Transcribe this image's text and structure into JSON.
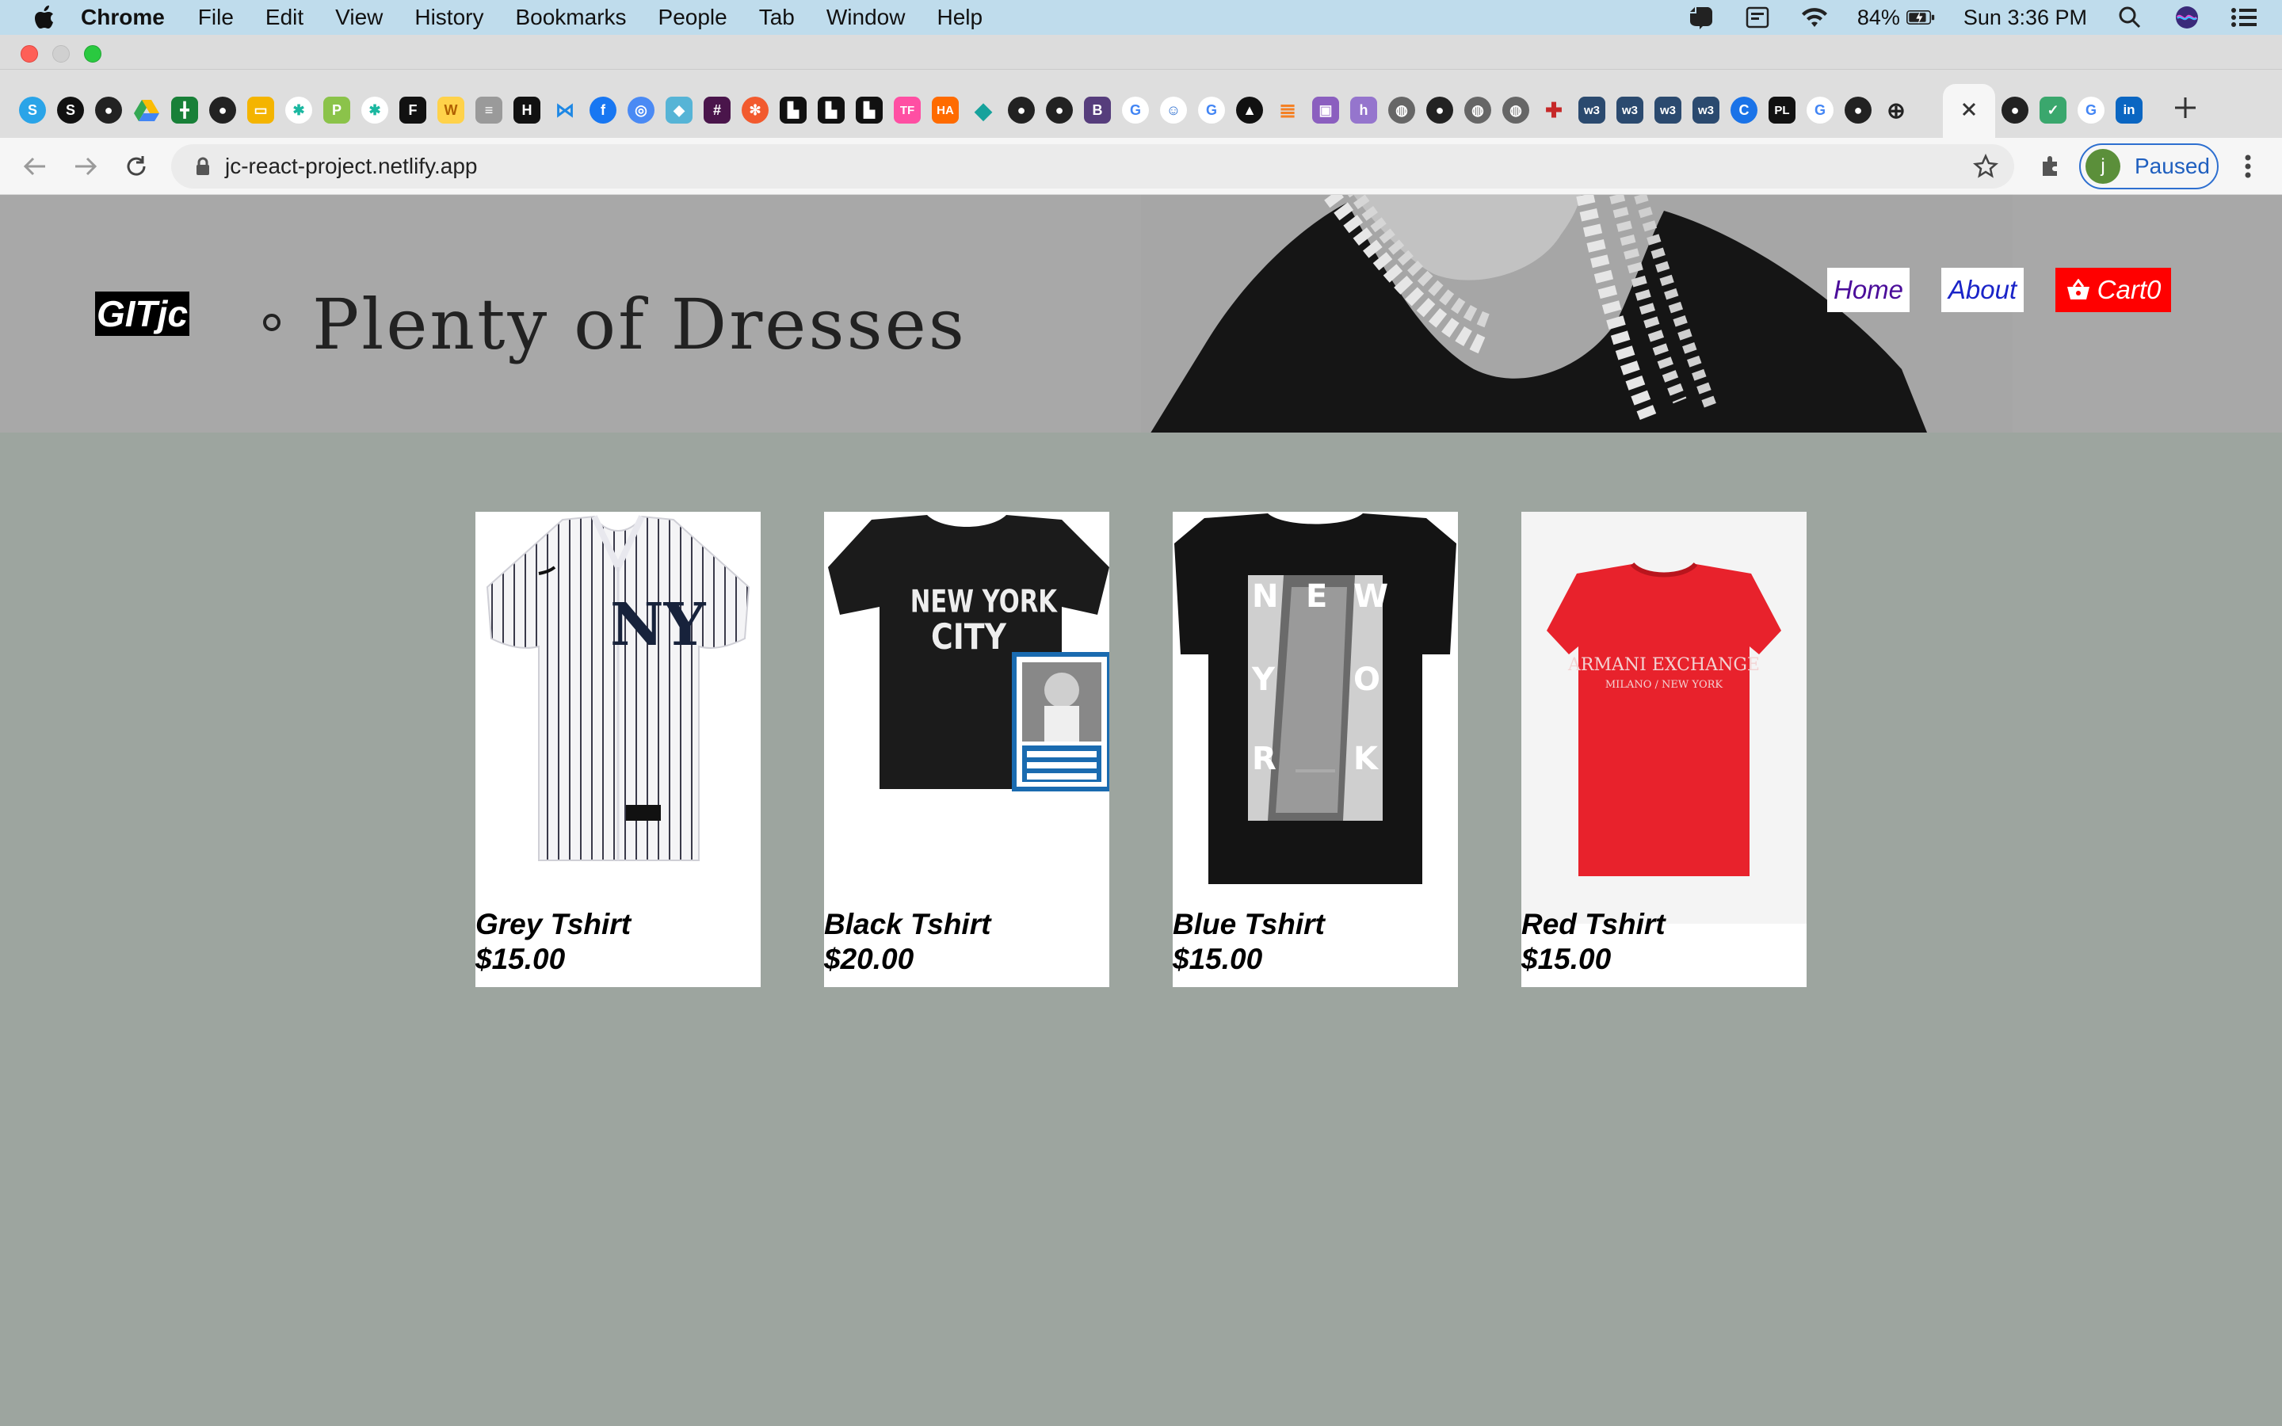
{
  "menubar": {
    "app": "Chrome",
    "items": [
      "File",
      "Edit",
      "View",
      "History",
      "Bookmarks",
      "People",
      "Tab",
      "Window",
      "Help"
    ],
    "battery": "84%",
    "clock": "Sun 3:36 PM"
  },
  "toolbar": {
    "url": "jc-react-project.netlify.app",
    "profile_initial": "j",
    "profile_label": "Paused"
  },
  "site": {
    "logo": "GITjc",
    "tagline": "Plenty of Dresses",
    "nav": {
      "home": "Home",
      "about": "About",
      "cart": "Cart0"
    }
  },
  "products": [
    {
      "name": "Grey Tshirt",
      "price": "$15.00"
    },
    {
      "name": "Black Tshirt",
      "price": "$20.00"
    },
    {
      "name": "Blue Tshirt",
      "price": "$15.00"
    },
    {
      "name": "Red Tshirt",
      "price": "$15.00"
    }
  ],
  "colors": {
    "page_bg": "#9da59f",
    "cart_red": "#ff0000",
    "home_link": "#4b0d9a",
    "about_link": "#1a24c8"
  }
}
